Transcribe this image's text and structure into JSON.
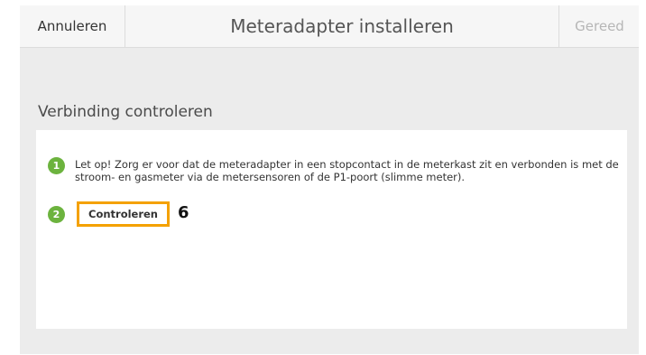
{
  "header": {
    "cancel_label": "Annuleren",
    "title": "Meteradapter installeren",
    "done_label": "Gereed"
  },
  "section": {
    "title": "Verbinding controleren"
  },
  "steps": [
    {
      "number": "1",
      "text": "Let op! Zorg er voor dat de meteradapter in een stopcontact in de meterkast zit en verbonden is met de stroom- en gasmeter via de metersensoren of de P1-poort (slimme meter)."
    },
    {
      "number": "2",
      "button_label": "Controleren"
    }
  ],
  "annotation": {
    "marker": "6"
  },
  "colors": {
    "accent_green": "#6cb33e",
    "highlight_orange": "#f4a100"
  }
}
